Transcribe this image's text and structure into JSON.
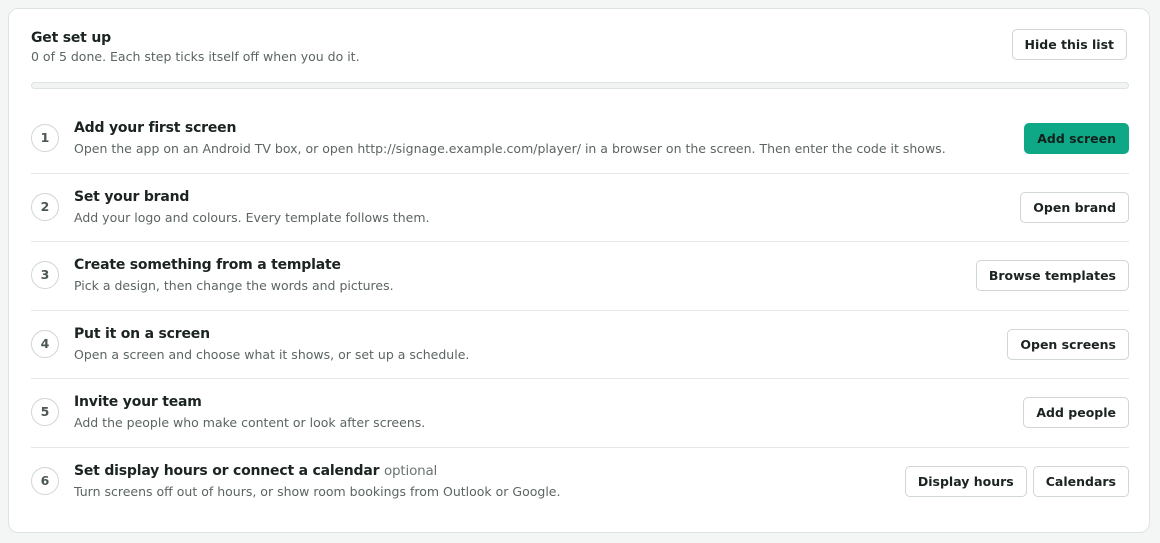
{
  "header": {
    "title": "Get set up",
    "subtitle": "0 of 5 done. Each step ticks itself off when you do it.",
    "hide_label": "Hide this list"
  },
  "progress": {
    "done": 0,
    "total": 5,
    "fraction": 0
  },
  "colors": {
    "accent": "#0fa887",
    "border": "#dde3e1",
    "muted_text": "#5b6563"
  },
  "steps": [
    {
      "number": "1",
      "title": "Add your first screen",
      "optional": "",
      "description": "Open the app on an Android TV box, or open http://signage.example.com/player/ in a browser on the screen. Then enter the code it shows.",
      "actions": [
        "Add screen"
      ]
    },
    {
      "number": "2",
      "title": "Set your brand",
      "optional": "",
      "description": "Add your logo and colours. Every template follows them.",
      "actions": [
        "Open brand"
      ]
    },
    {
      "number": "3",
      "title": "Create something from a template",
      "optional": "",
      "description": "Pick a design, then change the words and pictures.",
      "actions": [
        "Browse templates"
      ]
    },
    {
      "number": "4",
      "title": "Put it on a screen",
      "optional": "",
      "description": "Open a screen and choose what it shows, or set up a schedule.",
      "actions": [
        "Open screens"
      ]
    },
    {
      "number": "5",
      "title": "Invite your team",
      "optional": "",
      "description": "Add the people who make content or look after screens.",
      "actions": [
        "Add people"
      ]
    },
    {
      "number": "6",
      "title": "Set display hours or connect a calendar",
      "optional": "optional",
      "description": "Turn screens off out of hours, or show room bookings from Outlook or Google.",
      "actions": [
        "Display hours",
        "Calendars"
      ]
    }
  ]
}
